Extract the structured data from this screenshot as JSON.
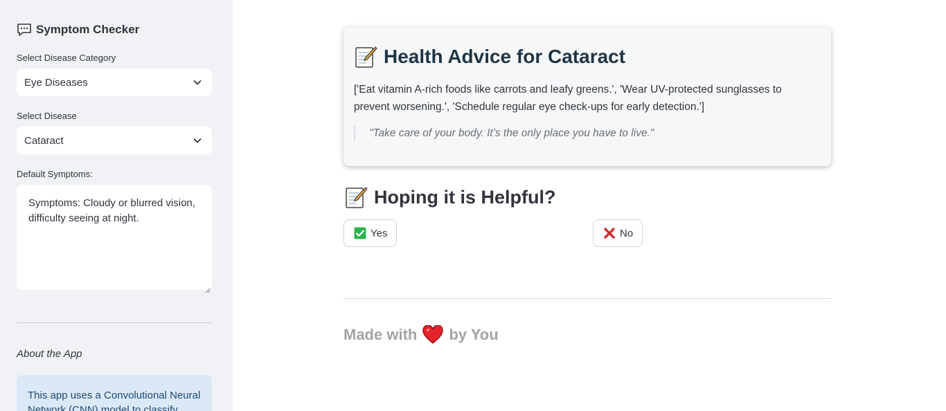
{
  "sidebar": {
    "title": "Symptom Checker",
    "title_icon": "chat-bubble-icon",
    "category_label": "Select Disease Category",
    "category_value": "Eye Diseases",
    "disease_label": "Select Disease",
    "disease_value": "Cataract",
    "symptoms_label": "Default Symptoms:",
    "symptoms_text": "Symptoms: Cloudy or blurred vision, difficulty seeing at night.",
    "about_label": "About the App",
    "about_text": "This app uses a Convolutional Neural Network (CNN) model to classify"
  },
  "main": {
    "card_title": "Health Advice for Cataract",
    "advice_text": "['Eat vitamin A-rich foods like carrots and leafy greens.', 'Wear UV-protected sunglasses to prevent worsening.', 'Schedule regular eye check-ups for early detection.']",
    "quote": "\"Take care of your body. It’s the only place you have to live.\"",
    "feedback_heading": "Hoping it is Helpful?",
    "yes_label": "Yes",
    "no_label": "No",
    "footer_prefix": "Made with",
    "footer_suffix": "by You"
  },
  "colors": {
    "sidebar_bg": "#f0f2f6",
    "card_bg": "#f6f7f9",
    "info_bg": "#dbe9f6",
    "heading": "#1f3545",
    "footer_text": "#a3a3a8"
  }
}
